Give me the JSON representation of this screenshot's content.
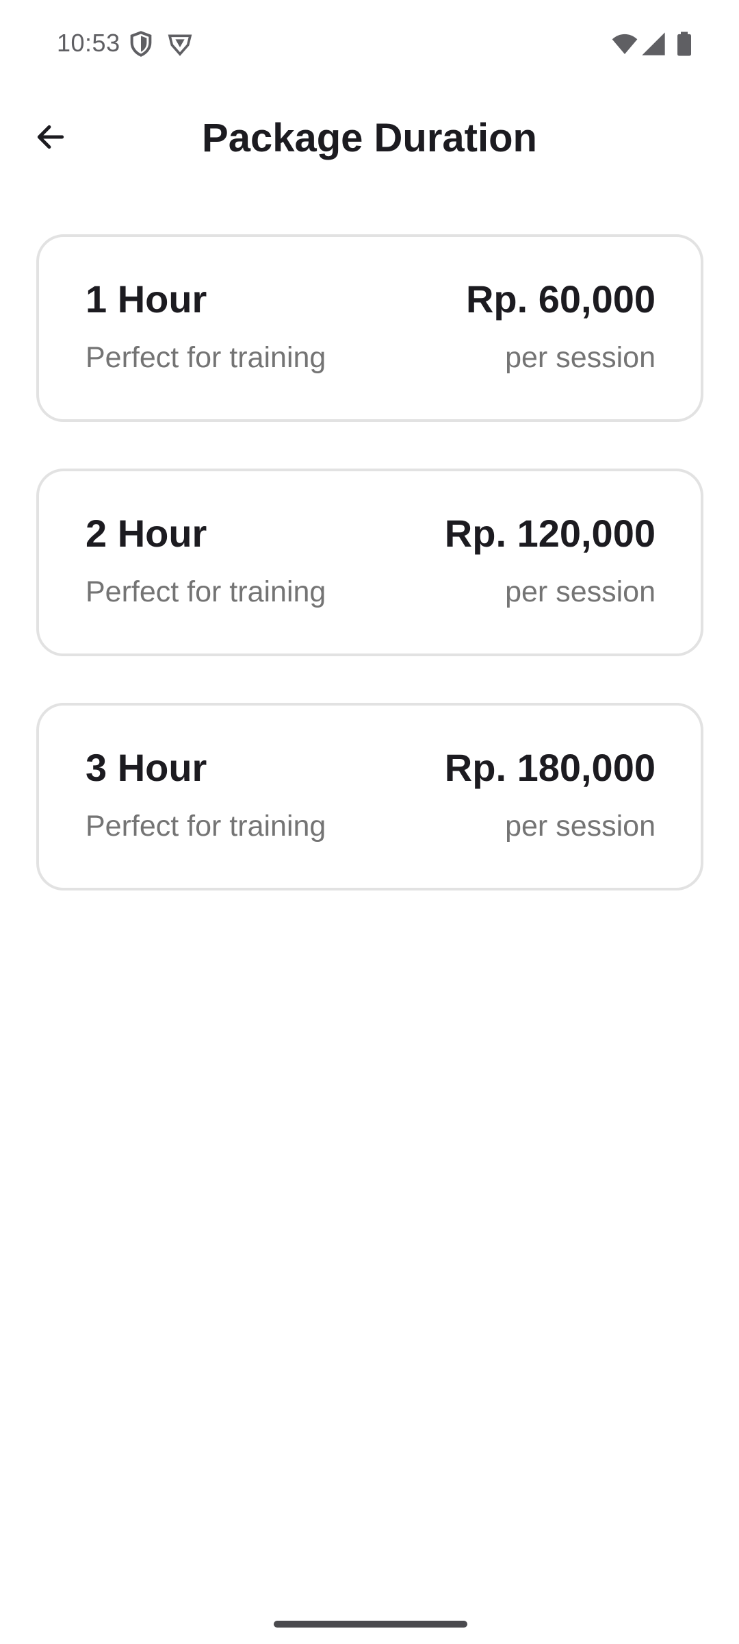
{
  "status_bar": {
    "time": "10:53",
    "icons": [
      "shield-icon",
      "vpn-badge-icon",
      "wifi-icon",
      "signal-icon",
      "battery-icon"
    ]
  },
  "header": {
    "title": "Package Duration",
    "back_icon": "arrow-left-icon"
  },
  "packages": [
    {
      "name": "1 Hour",
      "description": "Perfect for training",
      "price": "Rp. 60,000",
      "unit": "per session"
    },
    {
      "name": "2 Hour",
      "description": "Perfect for training",
      "price": "Rp. 120,000",
      "unit": "per session"
    },
    {
      "name": "3 Hour",
      "description": "Perfect for training",
      "price": "Rp. 180,000",
      "unit": "per session"
    }
  ],
  "colors": {
    "text_primary": "#1c1b20",
    "text_secondary": "#747474",
    "card_border": "#e2e2e2",
    "background": "#ffffff"
  }
}
